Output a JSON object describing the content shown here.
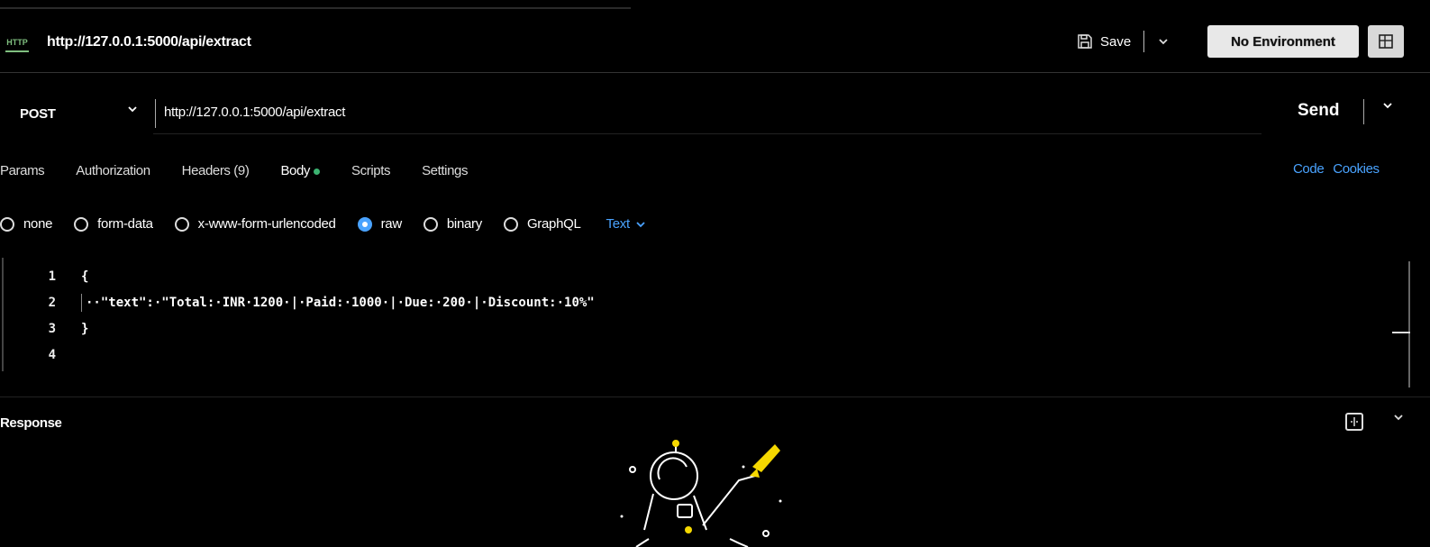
{
  "tab": {
    "method_badge": "HTTP",
    "title": "http://127.0.0.1:5000/api/extract"
  },
  "toolbar": {
    "save_label": "Save",
    "environment": "No Environment"
  },
  "request": {
    "method": "POST",
    "url": "http://127.0.0.1:5000/api/extract",
    "send_label": "Send"
  },
  "tabs": [
    {
      "label": "Params"
    },
    {
      "label": "Authorization"
    },
    {
      "label": "Headers (9)"
    },
    {
      "label": "Body"
    },
    {
      "label": "Scripts"
    },
    {
      "label": "Settings"
    }
  ],
  "links": {
    "code": "Code",
    "cookies": "Cookies"
  },
  "body_types": [
    {
      "label": "none",
      "selected": false
    },
    {
      "label": "form-data",
      "selected": false
    },
    {
      "label": "x-www-form-urlencoded",
      "selected": false
    },
    {
      "label": "raw",
      "selected": true
    },
    {
      "label": "binary",
      "selected": false
    },
    {
      "label": "GraphQL",
      "selected": false
    }
  ],
  "format": "Text",
  "code_lines": [
    {
      "num": "1",
      "text": "{"
    },
    {
      "num": "2",
      "text": "··\"text\":·\"Total:·INR·1200·|·Paid:·1000·|·Due:·200·|·Discount:·10%\""
    },
    {
      "num": "3",
      "text": "}"
    },
    {
      "num": "4",
      "text": ""
    }
  ],
  "response": {
    "label": "Response"
  },
  "colors": {
    "accent": "#4aa3ff",
    "body_dot": "#3cb371",
    "rocket": "#f5d800"
  }
}
